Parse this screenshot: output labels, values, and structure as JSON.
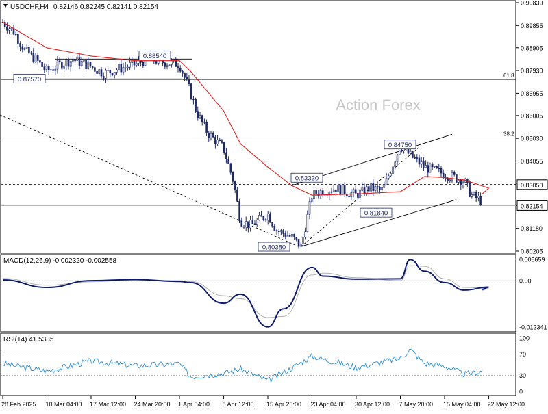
{
  "header": {
    "symbol_timeframe": "USDCHF,H4",
    "ohlc": "0.82146 0.82245 0.82141 0.82154"
  },
  "watermark": "Action Forex",
  "colors": {
    "bull_candle": "#1f2a66",
    "ma_line": "#e02020",
    "macd_line": "#0d1b6b",
    "signal_line": "#b0b0b0",
    "rsi_line": "#2a8fd6",
    "price_tag": "#ffffff"
  },
  "chart_data": [
    {
      "type": "candlestick",
      "title": "USDCHF,H4",
      "ylim": [
        0.80205,
        0.9083
      ],
      "y_ticks": [
        "0.90830",
        "0.89855",
        "0.88905",
        "0.87930",
        "0.86955",
        "0.86005",
        "0.85030",
        "0.84055",
        "0.83105",
        "0.82154",
        "0.81180",
        "0.80205"
      ],
      "x_ticks": [
        "28 Feb 2025",
        "10 Mar 04:00",
        "17 Mar 12:00",
        "24 Mar 20:00",
        "1 Apr 04:00",
        "8 Apr 12:00",
        "15 Apr 20:00",
        "23 Apr 04:00",
        "30 Apr 12:00",
        "7 May 20:00",
        "15 May 04:00",
        "22 May 12:00"
      ],
      "series": [
        {
          "kind": "close",
          "x": [
            "28 Feb 2025",
            "3 Mar",
            "5 Mar",
            "7 Mar",
            "10 Mar 04:00",
            "12 Mar",
            "14 Mar",
            "17 Mar 12:00",
            "19 Mar",
            "21 Mar",
            "24 Mar 20:00",
            "26 Mar",
            "28 Mar",
            "1 Apr 04:00",
            "3 Apr",
            "4 Apr",
            "7 Apr",
            "8 Apr 12:00",
            "10 Apr",
            "11 Apr",
            "14 Apr",
            "15 Apr 20:00",
            "17 Apr",
            "21 Apr",
            "22 Apr",
            "23 Apr 04:00",
            "25 Apr",
            "28 Apr",
            "30 Apr 12:00",
            "2 May",
            "5 May",
            "7 May 20:00",
            "9 May",
            "12 May",
            "15 May 04:00",
            "19 May",
            "20 May",
            "22 May 12:00",
            "23 May"
          ],
          "values": [
            0.9,
            0.896,
            0.888,
            0.884,
            0.879,
            0.882,
            0.884,
            0.881,
            0.878,
            0.88,
            0.882,
            0.8845,
            0.883,
            0.882,
            0.87,
            0.862,
            0.853,
            0.846,
            0.832,
            0.815,
            0.813,
            0.818,
            0.811,
            0.808,
            0.804,
            0.826,
            0.828,
            0.829,
            0.826,
            0.829,
            0.828,
            0.8475,
            0.843,
            0.838,
            0.835,
            0.832,
            0.826,
            0.822,
            0.82154
          ]
        },
        {
          "kind": "moving_average",
          "x": [
            "28 Feb 2025",
            "10 Mar 04:00",
            "17 Mar 12:00",
            "24 Mar 20:00",
            "1 Apr 04:00",
            "3 Apr",
            "8 Apr 12:00",
            "11 Apr",
            "15 Apr 20:00",
            "21 Apr",
            "23 Apr 04:00",
            "30 Apr 12:00",
            "7 May 20:00",
            "12 May",
            "15 May 04:00",
            "19 May",
            "22 May 12:00",
            "23 May"
          ],
          "values": [
            0.9,
            0.889,
            0.8855,
            0.8835,
            0.8835,
            0.879,
            0.862,
            0.848,
            0.838,
            0.83,
            0.826,
            0.8265,
            0.8275,
            0.834,
            0.8335,
            0.8325,
            0.829,
            0.8265
          ]
        }
      ],
      "levels": [
        {
          "label": "61.8",
          "value": 0.8755
        },
        {
          "label": "38.2",
          "value": 0.8505
        },
        {
          "label": "0.83050",
          "value": 0.8305,
          "style": "dashed"
        },
        {
          "label": "0.82154",
          "value": 0.82154,
          "style": "current"
        }
      ],
      "annotations": [
        "0.88540",
        "0.87570",
        "0.84750",
        "0.83330",
        "0.81840",
        "0.80380"
      ]
    },
    {
      "type": "line",
      "title": "MACD(12,26,9) -0.002320 -0.002558",
      "ylim": [
        -0.012341,
        0.005659
      ],
      "y_ticks": [
        "0.005659",
        "0.00",
        "-0.012341"
      ],
      "x": [
        "28 Feb 2025",
        "10 Mar 04:00",
        "17 Mar 12:00",
        "24 Mar 20:00",
        "1 Apr 04:00",
        "3 Apr",
        "8 Apr 12:00",
        "11 Apr",
        "15 Apr 20:00",
        "18 Apr",
        "23 Apr 04:00",
        "25 Apr",
        "30 Apr 12:00",
        "7 May 20:00",
        "9 May",
        "12 May",
        "15 May 04:00",
        "19 May",
        "22 May 12:00",
        "23 May"
      ],
      "series": [
        {
          "name": "MACD",
          "values": [
            0.0002,
            -0.0018,
            0.0,
            0.0003,
            -0.0002,
            -0.0005,
            -0.006,
            -0.0036,
            -0.0123,
            -0.0075,
            0.0035,
            0.0012,
            0.0004,
            0.0005,
            0.0056,
            0.0025,
            -0.0005,
            -0.0025,
            -0.0017,
            -0.00232
          ]
        },
        {
          "name": "Signal",
          "values": [
            0.0006,
            -0.0012,
            -0.0003,
            0.0002,
            0.0,
            -0.0002,
            -0.004,
            -0.0048,
            -0.0098,
            -0.0095,
            0.0015,
            0.002,
            0.0008,
            0.0,
            0.004,
            0.0038,
            0.0005,
            -0.0018,
            -0.002,
            -0.002558
          ]
        }
      ]
    },
    {
      "type": "line",
      "title": "RSI(14) 41.5335",
      "ylim": [
        0,
        100
      ],
      "y_ticks": [
        "100",
        "70",
        "30",
        "0"
      ],
      "levels": [
        70,
        30
      ],
      "x": [
        "28 Feb 2025",
        "10 Mar 04:00",
        "17 Mar 12:00",
        "24 Mar 20:00",
        "1 Apr 04:00",
        "3 Apr",
        "8 Apr 12:00",
        "11 Apr",
        "15 Apr 20:00",
        "18 Apr",
        "23 Apr 04:00",
        "30 Apr 12:00",
        "7 May 20:00",
        "9 May",
        "12 May",
        "15 May 04:00",
        "19 May",
        "22 May 12:00",
        "23 May"
      ],
      "series": [
        {
          "name": "RSI",
          "values": [
            52,
            38,
            57,
            48,
            52,
            28,
            34,
            42,
            20,
            35,
            66,
            45,
            62,
            79,
            52,
            48,
            32,
            40,
            41.5335
          ]
        }
      ]
    }
  ]
}
